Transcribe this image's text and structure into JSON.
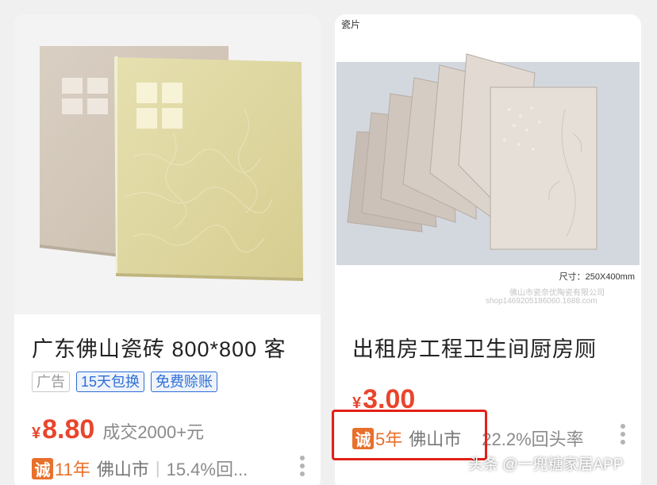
{
  "left_card": {
    "title": "广东佛山瓷砖 800*800 客",
    "tags": [
      "广告",
      "15天包换",
      "免费赊账"
    ],
    "currency": "¥",
    "price": "8.80",
    "sales": "成交2000+元",
    "seller_badge": "诚",
    "seller_years": "11年",
    "city": "佛山市",
    "divider": "|",
    "return_rate": "15.4%回..."
  },
  "right_card": {
    "image_corner_label": "瓷片",
    "image_size_label": "尺寸：250X400mm",
    "image_shop_name": "佛山市瓷奈优陶瓷有限公司",
    "image_shop_url": "shop1469205186060.1688.com",
    "title": "出租房工程卫生间厨房厕",
    "currency": "¥",
    "price": "3.00",
    "seller_badge": "诚",
    "seller_years": "5年",
    "city": "佛山市",
    "return_rate": "22.2%回头率"
  },
  "watermark": "头条 @一兜糖家居APP",
  "colors": {
    "price": "#e8452c",
    "badge": "#e8702c",
    "tag_blue": "#2f6fd6",
    "highlight": "#e32117"
  }
}
